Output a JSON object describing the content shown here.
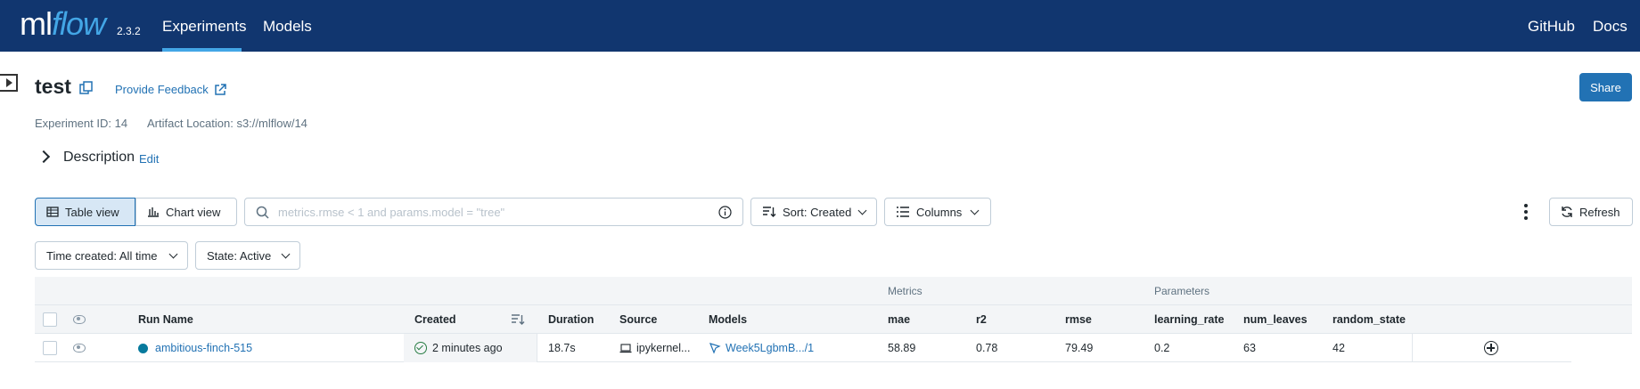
{
  "header": {
    "logo_ml": "ml",
    "logo_flow": "flow",
    "version": "2.3.2",
    "nav": [
      "Experiments",
      "Models"
    ],
    "right_links": [
      "GitHub",
      "Docs"
    ]
  },
  "experiment": {
    "title": "test",
    "feedback": "Provide Feedback",
    "share": "Share",
    "experiment_id": "Experiment ID: 14",
    "artifact_location": "Artifact Location: s3://mlflow/14",
    "description_label": "Description",
    "description_edit": "Edit"
  },
  "toolbar": {
    "table_view": "Table view",
    "chart_view": "Chart view",
    "search_placeholder": "metrics.rmse < 1 and params.model = \"tree\"",
    "sort": "Sort: Created",
    "columns": "Columns",
    "refresh": "Refresh",
    "time_filter": "Time created: All time",
    "state_filter": "State: Active"
  },
  "table": {
    "groups": {
      "metrics": "Metrics",
      "parameters": "Parameters"
    },
    "headers": {
      "run_name": "Run Name",
      "created": "Created",
      "duration": "Duration",
      "source": "Source",
      "models": "Models",
      "mae": "mae",
      "r2": "r2",
      "rmse": "rmse",
      "learning_rate": "learning_rate",
      "num_leaves": "num_leaves",
      "random_state": "random_state"
    },
    "rows": [
      {
        "run_name": "ambitious-finch-515",
        "created": "2 minutes ago",
        "duration": "18.7s",
        "source": "ipykernel...",
        "model": "Week5LgbmB.../1",
        "mae": "58.89",
        "r2": "0.78",
        "rmse": "79.49",
        "learning_rate": "0.2",
        "num_leaves": "63",
        "random_state": "42"
      }
    ]
  },
  "colors": {
    "header_bg": "#11366f",
    "accent": "#43a6e6",
    "primary": "#2272b4",
    "run_dot": "#077a9d"
  }
}
